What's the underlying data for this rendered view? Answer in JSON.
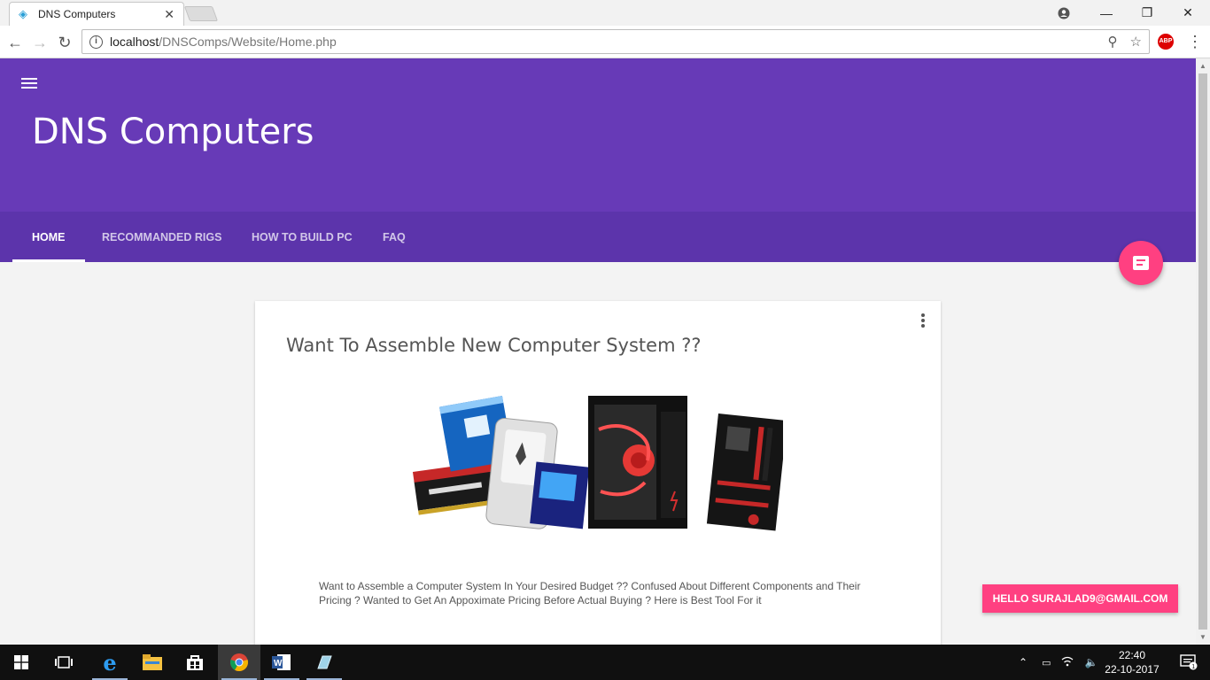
{
  "browser": {
    "tab_title": "DNS Computers",
    "url_host": "localhost",
    "url_path": "/DNSComps/Website/Home.php",
    "abp_label": "ABP"
  },
  "site": {
    "title": "DNS Computers",
    "nav_tabs": [
      {
        "label": "HOME",
        "active": true
      },
      {
        "label": "RECOMMANDED RIGS",
        "active": false
      },
      {
        "label": "HOW TO BUILD PC",
        "active": false
      },
      {
        "label": "FAQ",
        "active": false
      }
    ]
  },
  "card": {
    "title": "Want To Assemble New Computer System ??",
    "text": "Want to Assemble a Computer System In Your Desired Budget ?? Confused About Different Components and Their Pricing ? Wanted to Get An Appoximate Pricing Before Actual Buying ? Here is Best Tool For it"
  },
  "user_button": "HELLO SURAJLAD9@GMAIL.COM",
  "taskbar": {
    "time": "22:40",
    "date": "22-10-2017",
    "notification_count": "1"
  },
  "colors": {
    "header": "#673ab7",
    "tabs": "#5c34ab",
    "accent": "#ff4081"
  }
}
